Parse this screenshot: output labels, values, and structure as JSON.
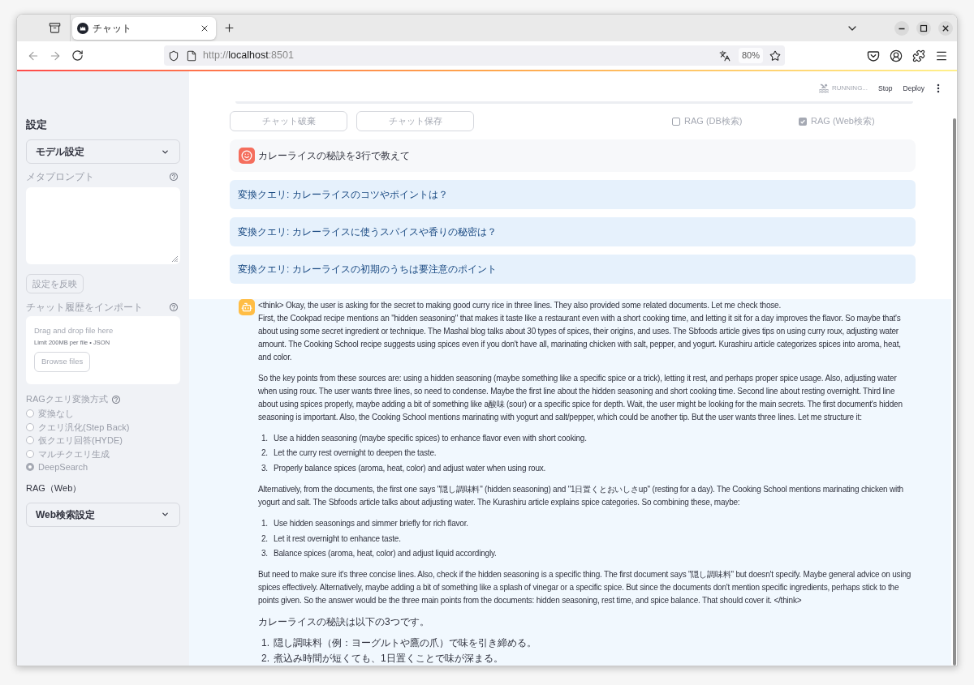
{
  "browser": {
    "tab": {
      "title": "チャット",
      "selected": true
    },
    "url": {
      "scheme": "http://",
      "host": "localhost",
      "port": ":8501"
    },
    "zoom": "80%"
  },
  "sidebar": {
    "title": "設定",
    "model_settings": {
      "label": "モデル設定",
      "expanded": false
    },
    "meta_prompt": {
      "label": "メタプロンプト",
      "disabled": true
    },
    "apply_button": {
      "label": "設定を反映",
      "disabled": true
    },
    "history_import": {
      "label": "チャット履歴をインポート",
      "drop_text": "Drag and drop file here",
      "limit_text": "Limit 200MB per file • JSON",
      "browse_button": "Browse files"
    },
    "query_transform": {
      "label": "RAGクエリ変換方式",
      "disabled": true,
      "options": [
        {
          "label": "変換なし",
          "selected": false
        },
        {
          "label": "クエリ汎化(Step Back)",
          "selected": false
        },
        {
          "label": "仮クエリ回答(HYDE)",
          "selected": false
        },
        {
          "label": "マルチクエリ生成",
          "selected": false
        },
        {
          "label": "DeepSearch",
          "selected": true
        }
      ]
    },
    "web_title": "RAG（Web）",
    "web_settings": {
      "label": "Web検索設定",
      "expanded": false
    }
  },
  "header": {
    "status": "RUNNING...",
    "actions": [
      "Stop",
      "Deploy"
    ]
  },
  "controls": {
    "buttons": [
      {
        "label": "チャット破棄",
        "disabled": true
      },
      {
        "label": "チャット保存",
        "disabled": true
      }
    ],
    "checkboxes": [
      {
        "label": "RAG (DB検索)",
        "checked": false,
        "disabled": true
      },
      {
        "label": "RAG (Web検索)",
        "checked": true,
        "disabled": true
      }
    ]
  },
  "chat": [
    {
      "kind": "user",
      "text": "カレーライスの秘訣を3行で教えて"
    },
    {
      "kind": "query_note",
      "text": "変換クエリ: カレーライスのコツやポイントは？"
    },
    {
      "kind": "query_note",
      "text": "変換クエリ: カレーライスに使うスパイスや香りの秘密は？"
    },
    {
      "kind": "query_note",
      "text": "変換クエリ: カレーライスの初期のうちは要注意のポイント"
    },
    {
      "kind": "assistant",
      "blocks": [
        {
          "kind": "paragraph",
          "text": "<think> Okay, the user is asking for the secret to making good curry rice in three lines. They also provided some related documents. Let me check those.\nFirst, the Cookpad recipe mentions an \"hidden seasoning\" that makes it taste like a restaurant even with a short cooking time, and letting it sit for a day improves the flavor. So maybe that's about using some secret ingredient or technique. The Mashal blog talks about 30 types of spices, their origins, and uses. The Sbfoods article gives tips on using curry roux, adjusting water amount. The Cooking School recipe suggests using spices even if you don't have all, marinating chicken with salt, pepper, and yogurt. Kurashiru article categorizes spices into aroma, heat, and color."
        },
        {
          "kind": "paragraph",
          "text": "So the key points from these sources are: using a hidden seasoning (maybe something like a specific spice or a trick), letting it rest, and perhaps proper spice usage. Also, adjusting water when using roux. The user wants three lines, so need to condense. Maybe the first line about the hidden seasoning and short cooking time. Second line about resting overnight. Third line about using spices properly, maybe adding a bit of something like a酸味 (sour) or a specific spice for depth. Wait, the user might be looking for the main secrets. The first document's hidden seasoning is important. Also, the Cooking School mentions marinating with yogurt and salt/pepper, which could be another tip. But the user wants three lines. Let me structure it:"
        },
        {
          "kind": "list",
          "items": [
            {
              "number": "1.",
              "text": "Use a hidden seasoning (maybe specific spices) to enhance flavor even with short cooking."
            },
            {
              "number": "2.",
              "text": "Let the curry rest overnight to deepen the taste."
            },
            {
              "number": "3.",
              "text": "Properly balance spices (aroma, heat, color) and adjust water when using roux."
            }
          ]
        },
        {
          "kind": "paragraph",
          "text": "Alternatively, from the documents, the first one says \"隠し調味料\" (hidden seasoning) and \"1日置くとおいしさup\" (resting for a day). The Cooking School mentions marinating chicken with yogurt and salt. The Sbfoods article talks about adjusting water. The Kurashiru article explains spice categories. So combining these, maybe:"
        },
        {
          "kind": "list",
          "items": [
            {
              "number": "1.",
              "text": "Use hidden seasonings and simmer briefly for rich flavor."
            },
            {
              "number": "2.",
              "text": "Let it rest overnight to enhance taste."
            },
            {
              "number": "3.",
              "text": "Balance spices (aroma, heat, color) and adjust liquid accordingly."
            }
          ]
        },
        {
          "kind": "paragraph",
          "text": "But need to make sure it's three concise lines. Also, check if the hidden seasoning is a specific thing. The first document says \"隠し調味料\" but doesn't specify. Maybe general advice on using spices effectively. Alternatively, maybe adding a bit of something like a splash of vinegar or a specific spice. But since the documents don't mention specific ingredients, perhaps stick to the points given. So the answer would be the three main points from the documents: hidden seasoning, rest time, and spice balance. That should cover it. </think>"
        },
        {
          "kind": "paragraph",
          "text": "カレーライスの秘訣は以下の3つです。"
        },
        {
          "kind": "list",
          "items": [
            {
              "number": "1.",
              "text": "隠し調味料（例：ヨーグルトや鷹の爪）で味を引き締める。"
            },
            {
              "number": "2.",
              "text": "煮込み時間が短くても、1日置くことで味が深まる。"
            }
          ]
        }
      ]
    }
  ]
}
